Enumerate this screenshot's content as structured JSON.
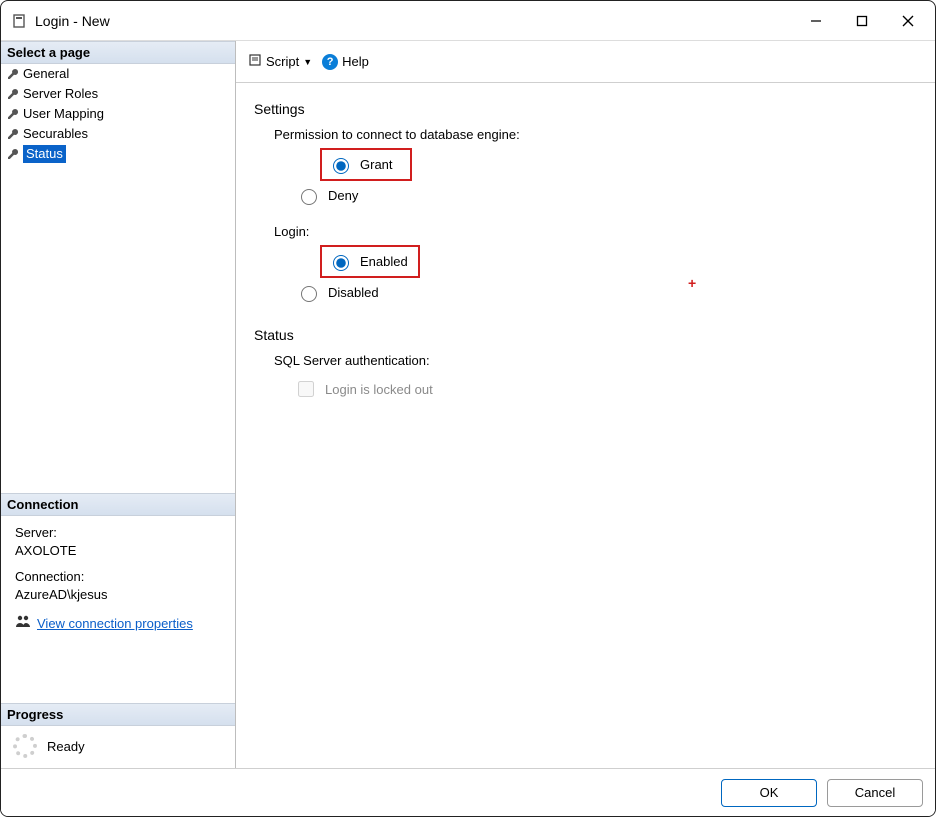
{
  "window": {
    "title": "Login - New"
  },
  "sidebar": {
    "header": "Select a page",
    "items": [
      {
        "label": "General"
      },
      {
        "label": "Server Roles"
      },
      {
        "label": "User Mapping"
      },
      {
        "label": "Securables"
      },
      {
        "label": "Status"
      }
    ]
  },
  "connection": {
    "header": "Connection",
    "server_label": "Server:",
    "server_value": "AXOLOTE",
    "connection_label": "Connection:",
    "connection_value": "AzureAD\\kjesus",
    "view_props": "View connection properties"
  },
  "progress": {
    "header": "Progress",
    "status": "Ready"
  },
  "toolbar": {
    "script": "Script",
    "help": "Help"
  },
  "content": {
    "settings_title": "Settings",
    "perm_label": "Permission to connect to database engine:",
    "grant": "Grant",
    "deny": "Deny",
    "login_label": "Login:",
    "enabled": "Enabled",
    "disabled": "Disabled",
    "status_title": "Status",
    "sql_auth": "SQL Server authentication:",
    "locked_out": "Login is locked out"
  },
  "buttons": {
    "ok": "OK",
    "cancel": "Cancel"
  }
}
